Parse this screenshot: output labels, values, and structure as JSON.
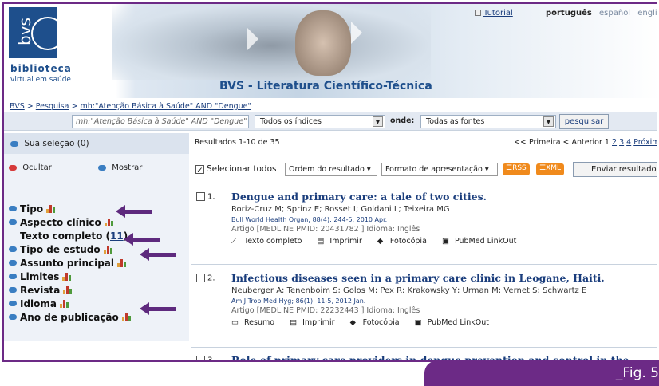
{
  "header": {
    "logo_lines": [
      "biblioteca",
      "virtual em saúde"
    ],
    "logo_mark": "bvs",
    "site_title": "BVS - Literatura Científico-Técnica",
    "tutorial_link": "Tutorial",
    "languages": {
      "current": "português",
      "others": [
        "español",
        "english"
      ]
    }
  },
  "breadcrumb": {
    "items": [
      "BVS",
      "Pesquisa",
      "mh:\"Atenção Básica à Saúde\" AND \"Dengue\""
    ],
    "separator": ">"
  },
  "search": {
    "query_value": "mh:\"Atenção Básica à Saúde\" AND \"Dengue\"",
    "index_select": "Todos os índices",
    "onde_label": "onde:",
    "source_select": "Todas as fontes",
    "submit_label": "pesquisar"
  },
  "sidebar": {
    "selection_label": "Sua seleção",
    "selection_count": "(0)",
    "hide_label": "Ocultar",
    "show_label": "Mostrar",
    "facets": [
      {
        "label": "Tipo",
        "chart": true
      },
      {
        "label": "Aspecto clínico",
        "chart": true
      },
      {
        "label": "Texto completo (",
        "link": "11",
        "suffix": ")",
        "sub": true
      },
      {
        "label": "Tipo de estudo",
        "chart": true
      },
      {
        "label": "Assunto principal",
        "chart": true
      },
      {
        "label": "Limites",
        "chart": true
      },
      {
        "label": "Revista",
        "chart": true
      },
      {
        "label": "Idioma",
        "chart": true
      },
      {
        "label": "Ano de publicação",
        "chart": true
      }
    ]
  },
  "results": {
    "summary": "Resultados 1-10 de 35",
    "pagination": {
      "first": "<< Primeira",
      "prev": "< Anterior",
      "pages": [
        "1",
        "2",
        "3",
        "4"
      ],
      "next": "Próxima >"
    },
    "toolbar": {
      "select_all": "Selecionar todos",
      "order_select": "Ordem do resultado",
      "format_select": "Formato de apresentação",
      "rss": "RSS",
      "xml": "XML",
      "send": "Enviar resultado"
    },
    "items": [
      {
        "num": "1.",
        "title": "Dengue and primary care: a tale of two cities.",
        "authors": "Roriz-Cruz M; Sprinz E; Rosset I; Goldani L; Teixeira MG",
        "journal": "Bull World Health Organ; 88(4): 244-5, 2010 Apr.",
        "meta": "Artigo [MEDLINE PMID: 20431782 ] Idioma: Inglês",
        "actions": [
          "Texto completo",
          "Imprimir",
          "Fotocópia",
          "PubMed LinkOut"
        ]
      },
      {
        "num": "2.",
        "title": "Infectious diseases seen in a primary care clinic in Leogane, Haiti.",
        "authors": "Neuberger A; Tenenboim S; Golos M; Pex R; Krakowsky Y; Urman M; Vernet S; Schwartz E",
        "journal": "Am J Trop Med Hyg; 86(1): 11-5, 2012 Jan.",
        "meta": "Artigo [MEDLINE PMID: 22232443 ] Idioma: Inglês",
        "actions": [
          "Resumo",
          "Imprimir",
          "Fotocópia",
          "PubMed LinkOut"
        ]
      },
      {
        "num": "3.",
        "title": "Role of primary care providers in dengue prevention and control in the"
      }
    ]
  },
  "figure_label": "_Fig. 5",
  "colors": {
    "frame": "#6c2a86",
    "link": "#1a3d7c",
    "rss": "#f08a1c",
    "arrow": "#5e2a7e"
  }
}
